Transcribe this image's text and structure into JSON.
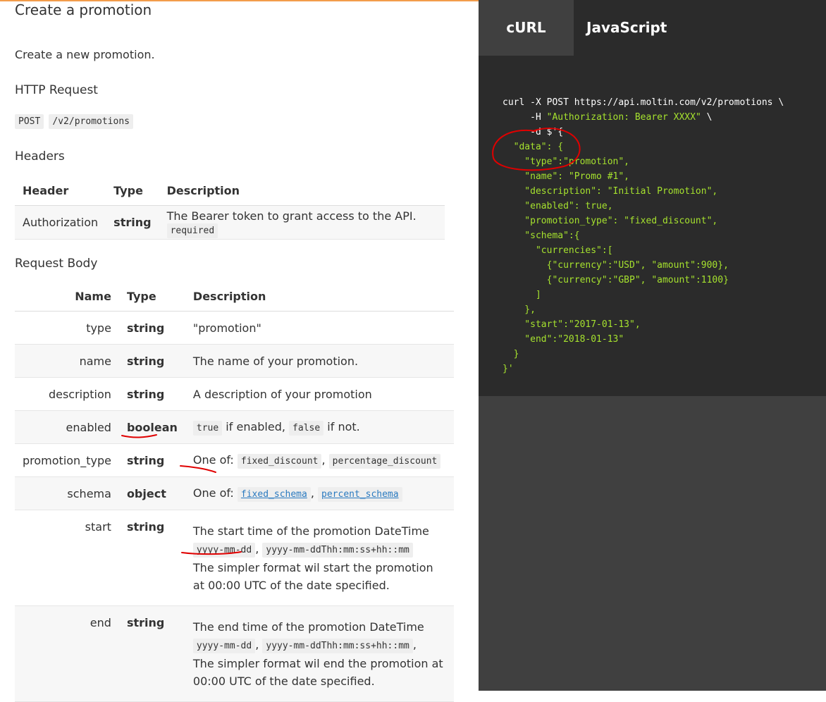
{
  "page": {
    "title": "Create a promotion",
    "intro": "Create a new promotion.",
    "http_request_heading": "HTTP Request",
    "method": "POST",
    "endpoint": "/v2/promotions",
    "headers_heading": "Headers",
    "request_body_heading": "Request Body"
  },
  "headers_table": {
    "columns": [
      "Header",
      "Type",
      "Description"
    ],
    "rows": [
      {
        "header": "Authorization",
        "type": "string",
        "description": "The Bearer token to grant access to the API.",
        "badge": "required"
      }
    ]
  },
  "body_table": {
    "columns": [
      "Name",
      "Type",
      "Description"
    ],
    "rows": [
      {
        "name": "type",
        "type": "string",
        "description": "\"promotion\""
      },
      {
        "name": "name",
        "type": "string",
        "description": "The name of your promotion."
      },
      {
        "name": "description",
        "type": "string",
        "description": "A description of your promotion"
      },
      {
        "name": "enabled",
        "type": "boolean",
        "code1": "true",
        "text1": " if enabled,",
        "code2": "false",
        "text2": " if not."
      },
      {
        "name": "promotion_type",
        "type": "string",
        "prefix": "One of:",
        "code1": "fixed_discount",
        "sep": ",",
        "code2": "percentage_discount"
      },
      {
        "name": "schema",
        "type": "object",
        "prefix": "One of:",
        "code1": "fixed_schema",
        "sep": ",",
        "code2": "percent_schema"
      },
      {
        "name": "start",
        "type": "string",
        "line1": "The start time of the promotion DateTime",
        "code1": "yyyy-mm-dd",
        "sep": ",",
        "code2": "yyyy-mm-ddThh:mm:ss+hh::mm",
        "tail": "The simpler format wil start the promotion at 00:00 UTC of the date specified."
      },
      {
        "name": "end",
        "type": "string",
        "line1": "The end time of the promotion DateTime",
        "code1": "yyyy-mm-dd",
        "sep": ",",
        "code2": "yyyy-mm-ddThh:mm:ss+hh::mm",
        "sep2": ",",
        "tail": "The simpler format wil end the promotion at 00:00 UTC of the date specified."
      }
    ]
  },
  "code_panel": {
    "tabs": [
      "cURL",
      "JavaScript"
    ],
    "lines": [
      "curl -X POST https://api.moltin.com/v2/promotions \\",
      "     -H \"Authorization: Bearer XXXX\" \\",
      "     -d $'{",
      "  \"data\": {",
      "    \"type\":\"promotion\",",
      "    \"name\": \"Promo #1\",",
      "    \"description\": \"Initial Promotion\",",
      "    \"enabled\": true,",
      "    \"promotion_type\": \"fixed_discount\",",
      "    \"schema\":{",
      "      \"currencies\":[",
      "        {\"currency\":\"USD\", \"amount\":900},",
      "        {\"currency\":\"GBP\", \"amount\":1100}",
      "      ]",
      "    },",
      "    \"start\":\"2017-01-13\",",
      "    \"end\":\"2018-01-13\"",
      "  }",
      "}'"
    ]
  },
  "colors": {
    "accent": "#f39c4b",
    "code_text": "#a6e22e",
    "annotation": "#e00000",
    "link": "#2a7ac0"
  }
}
